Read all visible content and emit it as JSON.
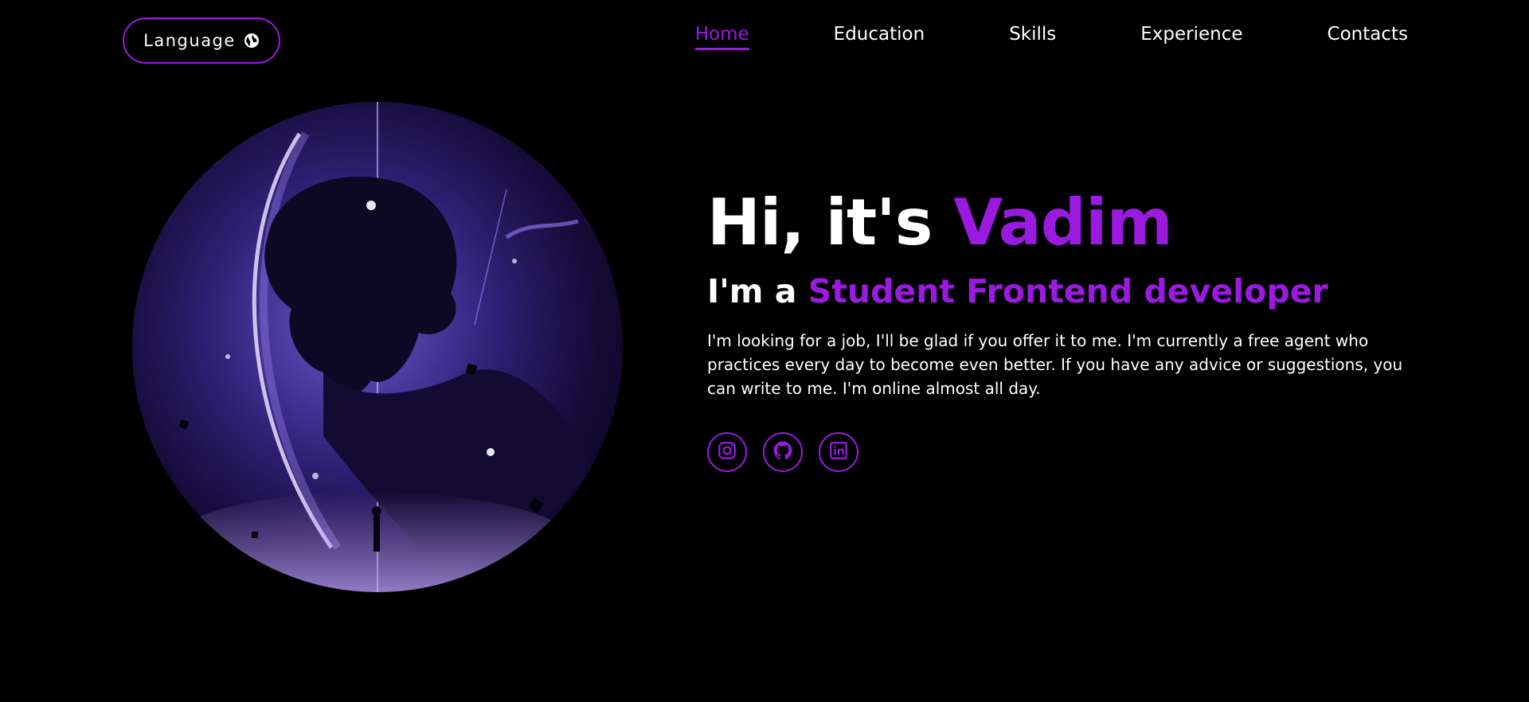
{
  "header": {
    "language_label": "Language",
    "language_icon": "globe-icon",
    "nav": [
      {
        "label": "Home",
        "active": true
      },
      {
        "label": "Education",
        "active": false
      },
      {
        "label": "Skills",
        "active": false
      },
      {
        "label": "Experience",
        "active": false
      },
      {
        "label": "Contacts",
        "active": false
      }
    ]
  },
  "hero": {
    "greeting_prefix": "Hi, it's ",
    "name": "Vadim",
    "role_prefix": "I'm a ",
    "role": "Student Frontend developer",
    "description": "I'm looking for a job, I'll be glad if you offer it to me. I'm currently a free agent who practices every day to become even better. If you have any advice or suggestions, you can write to me. I'm online almost all day.",
    "socials": [
      {
        "icon": "instagram-icon"
      },
      {
        "icon": "github-icon"
      },
      {
        "icon": "linkedin-icon"
      }
    ]
  },
  "colors": {
    "accent": "#9b1ae0",
    "background": "#000000",
    "text": "#ffffff"
  }
}
